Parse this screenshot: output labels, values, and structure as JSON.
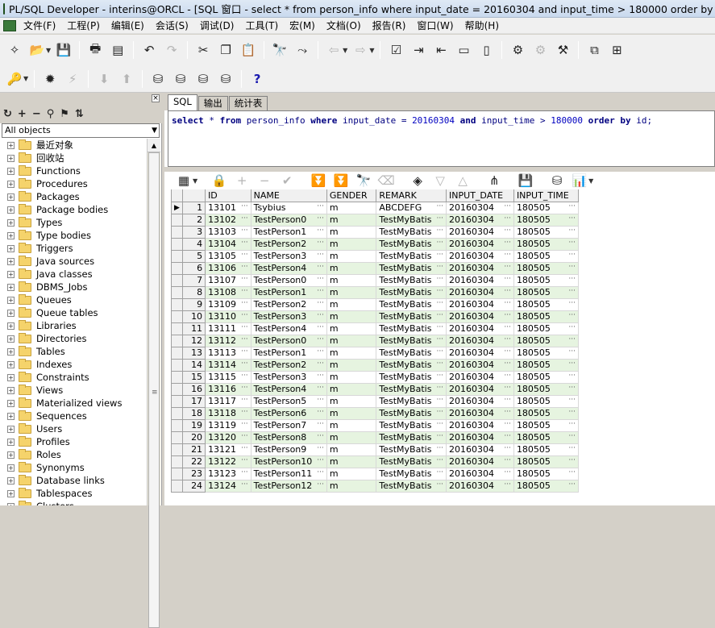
{
  "window": {
    "title": "PL/SQL Developer - interins@ORCL - [SQL 窗口 - select * from person_info where input_date = 20160304 and input_time > 180000 order by id;]"
  },
  "menu": [
    "文件(F)",
    "工程(P)",
    "编辑(E)",
    "会话(S)",
    "调试(D)",
    "工具(T)",
    "宏(M)",
    "文档(O)",
    "报告(R)",
    "窗口(W)",
    "帮助(H)"
  ],
  "object_browser": {
    "selector": "All objects",
    "nodes": [
      "最近对象",
      "回收站",
      "Functions",
      "Procedures",
      "Packages",
      "Package bodies",
      "Types",
      "Type bodies",
      "Triggers",
      "Java sources",
      "Java classes",
      "DBMS_Jobs",
      "Queues",
      "Queue tables",
      "Libraries",
      "Directories",
      "Tables",
      "Indexes",
      "Constraints",
      "Views",
      "Materialized views",
      "Sequences",
      "Users",
      "Profiles",
      "Roles",
      "Synonyms",
      "Database links",
      "Tablespaces",
      "Clusters"
    ]
  },
  "tabs": [
    "SQL",
    "输出",
    "统计表"
  ],
  "sql": {
    "tokens": [
      {
        "t": "select",
        "c": "kw"
      },
      {
        "t": " * ",
        "c": "plain"
      },
      {
        "t": "from",
        "c": "kw"
      },
      {
        "t": " person_info ",
        "c": "plain"
      },
      {
        "t": "where",
        "c": "kw"
      },
      {
        "t": " input_date = ",
        "c": "plain"
      },
      {
        "t": "20160304",
        "c": "num"
      },
      {
        "t": " ",
        "c": "plain"
      },
      {
        "t": "and",
        "c": "kw"
      },
      {
        "t": " input_time > ",
        "c": "plain"
      },
      {
        "t": "180000",
        "c": "num"
      },
      {
        "t": " ",
        "c": "plain"
      },
      {
        "t": "order by",
        "c": "kw"
      },
      {
        "t": " id;",
        "c": "plain"
      }
    ]
  },
  "grid": {
    "columns": [
      "ID",
      "NAME",
      "GENDER",
      "REMARK",
      "INPUT_DATE",
      "INPUT_TIME"
    ],
    "rows": [
      [
        "1",
        "13101",
        "Tsybius",
        "m",
        "ABCDEFG",
        "20160304",
        "180505"
      ],
      [
        "2",
        "13102",
        "TestPerson0",
        "m",
        "TestMyBatis",
        "20160304",
        "180505"
      ],
      [
        "3",
        "13103",
        "TestPerson1",
        "m",
        "TestMyBatis",
        "20160304",
        "180505"
      ],
      [
        "4",
        "13104",
        "TestPerson2",
        "m",
        "TestMyBatis",
        "20160304",
        "180505"
      ],
      [
        "5",
        "13105",
        "TestPerson3",
        "m",
        "TestMyBatis",
        "20160304",
        "180505"
      ],
      [
        "6",
        "13106",
        "TestPerson4",
        "m",
        "TestMyBatis",
        "20160304",
        "180505"
      ],
      [
        "7",
        "13107",
        "TestPerson0",
        "m",
        "TestMyBatis",
        "20160304",
        "180505"
      ],
      [
        "8",
        "13108",
        "TestPerson1",
        "m",
        "TestMyBatis",
        "20160304",
        "180505"
      ],
      [
        "9",
        "13109",
        "TestPerson2",
        "m",
        "TestMyBatis",
        "20160304",
        "180505"
      ],
      [
        "10",
        "13110",
        "TestPerson3",
        "m",
        "TestMyBatis",
        "20160304",
        "180505"
      ],
      [
        "11",
        "13111",
        "TestPerson4",
        "m",
        "TestMyBatis",
        "20160304",
        "180505"
      ],
      [
        "12",
        "13112",
        "TestPerson0",
        "m",
        "TestMyBatis",
        "20160304",
        "180505"
      ],
      [
        "13",
        "13113",
        "TestPerson1",
        "m",
        "TestMyBatis",
        "20160304",
        "180505"
      ],
      [
        "14",
        "13114",
        "TestPerson2",
        "m",
        "TestMyBatis",
        "20160304",
        "180505"
      ],
      [
        "15",
        "13115",
        "TestPerson3",
        "m",
        "TestMyBatis",
        "20160304",
        "180505"
      ],
      [
        "16",
        "13116",
        "TestPerson4",
        "m",
        "TestMyBatis",
        "20160304",
        "180505"
      ],
      [
        "17",
        "13117",
        "TestPerson5",
        "m",
        "TestMyBatis",
        "20160304",
        "180505"
      ],
      [
        "18",
        "13118",
        "TestPerson6",
        "m",
        "TestMyBatis",
        "20160304",
        "180505"
      ],
      [
        "19",
        "13119",
        "TestPerson7",
        "m",
        "TestMyBatis",
        "20160304",
        "180505"
      ],
      [
        "20",
        "13120",
        "TestPerson8",
        "m",
        "TestMyBatis",
        "20160304",
        "180505"
      ],
      [
        "21",
        "13121",
        "TestPerson9",
        "m",
        "TestMyBatis",
        "20160304",
        "180505"
      ],
      [
        "22",
        "13122",
        "TestPerson10",
        "m",
        "TestMyBatis",
        "20160304",
        "180505"
      ],
      [
        "23",
        "13123",
        "TestPerson11",
        "m",
        "TestMyBatis",
        "20160304",
        "180505"
      ],
      [
        "24",
        "13124",
        "TestPerson12",
        "m",
        "TestMyBatis",
        "20160304",
        "180505"
      ]
    ]
  },
  "colors": {
    "row_alt": "#e6f4e0",
    "sql_keyword": "#000080"
  }
}
